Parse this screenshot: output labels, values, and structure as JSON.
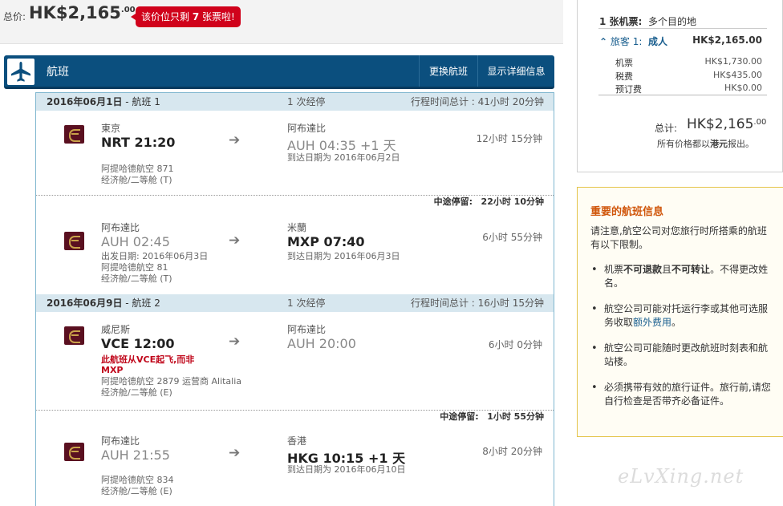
{
  "top": {
    "total_label": "总价:",
    "price_main": "HK$2,165",
    "price_cents": ".00",
    "alert_prefix": "该价位只剩 ",
    "alert_count": "7",
    "alert_suffix": " 张票啦!"
  },
  "flights_header": {
    "title": "航班",
    "change_button": "更换航班",
    "detail_button": "显示详细信息"
  },
  "segments": [
    {
      "date": "2016年06月1日",
      "flight_label": " - 航班 1",
      "stops": "1 次经停",
      "total_time": "行程时间总计 : 41小时 20分钟",
      "legs": [
        {
          "from_city": "東京",
          "from_time": "NRT 21:20",
          "to_city": "阿布達比",
          "to_time": "AUH 04:35 +1 天",
          "arrival_note": "到达日期为 2016年06月2日",
          "duration": "12小时 15分钟",
          "airline": "阿提哈德航空 871",
          "cabin": "经济舱/二等舱 (T)"
        },
        {
          "from_city": "阿布達比",
          "from_time": "AUH 02:45",
          "departure_note": "出发日期:   2016年06月3日",
          "to_city": "米蘭",
          "to_time": "MXP 07:40",
          "arrival_note": "到达日期为 2016年06月3日",
          "duration": "6小时 55分钟",
          "airline": "阿提哈德航空 81",
          "cabin": "经济舱/二等舱 (T)"
        }
      ],
      "layover_label": "中途停留:",
      "layover_time": "22小时 10分钟"
    },
    {
      "date": "2016年06月9日",
      "flight_label": " - 航班 2",
      "stops": "1 次经停",
      "total_time": "行程时间总计 : 16小时 15分钟",
      "legs": [
        {
          "from_city": "威尼斯",
          "from_time": "VCE 12:00",
          "warning_line1": "此航班从VCE起飞,而非",
          "warning_line2": "MXP",
          "to_city": "阿布達比",
          "to_time": "AUH 20:00",
          "duration": "6小时 0分钟",
          "airline": "阿提哈德航空 2879 运营商 Alitalia",
          "cabin": "经济舱/二等舱 (E)"
        },
        {
          "from_city": "阿布達比",
          "from_time": "AUH 21:55",
          "to_city": "香港",
          "to_time": "HKG 10:15 +1 天",
          "arrival_note": "到达日期为 2016年06月10日",
          "duration": "8小时 20分钟",
          "airline": "阿提哈德航空 834",
          "cabin": "经济舱/二等舱 (E)"
        }
      ],
      "layover_label": "中途停留:",
      "layover_time": "1小时 55分钟"
    }
  ],
  "summary": {
    "ticket_count": "1 张机票:",
    "ticket_type": "多个目的地",
    "passenger_label": "旅客 1:",
    "passenger_type": "成人",
    "passenger_amount": "HK$2,165.00",
    "rows": [
      {
        "label": "机票",
        "value": "HK$1,730.00"
      },
      {
        "label": "税费",
        "value": "HK$435.00"
      },
      {
        "label": "预订费",
        "value": "HK$0.00"
      }
    ],
    "total_label": "总计:",
    "total_main": "HK$2,165",
    "total_cents": ".00",
    "note_prefix": "所有价格都以",
    "note_currency": "港元",
    "note_suffix": "报出。"
  },
  "important": {
    "heading": "重要的航班信息",
    "intro": "请注意,航空公司对您旅行时所搭乘的航班有以下限制。",
    "item1_a": "机票",
    "item1_b": "不可退款",
    "item1_c": "且",
    "item1_d": "不可转让",
    "item1_e": "。不得更改姓名。",
    "item2_a": "航空公司可能对托运行李或其他可选服务收取",
    "item2_link": "额外费用",
    "item2_b": "。",
    "item3": "航空公司可能随时更改航班时刻表和航站楼。",
    "item4": "必须携带有效的旅行证件。旅行前,请您自行检查是否带齐必备证件。"
  },
  "watermark": "eLvXing.net"
}
